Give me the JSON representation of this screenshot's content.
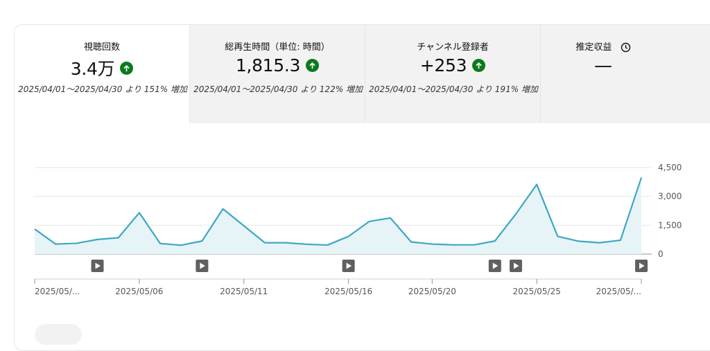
{
  "metrics": [
    {
      "label": "視聴回数",
      "value": "3.4万",
      "trend_icon": "arrow-up-circle-icon",
      "compare": "2025/04/01～2025/04/30 より 151% 増加",
      "active": true
    },
    {
      "label": "総再生時間（単位: 時間）",
      "value": "1,815.3",
      "trend_icon": "arrow-up-circle-icon",
      "compare": "2025/04/01～2025/04/30 より 122% 増加",
      "active": false
    },
    {
      "label": "チャンネル登録者",
      "value": "+253",
      "trend_icon": "arrow-up-circle-icon",
      "compare": "2025/04/01～2025/04/30 より 191% 増加",
      "active": false
    },
    {
      "label": "推定収益",
      "value": "—",
      "icon": "clock-icon",
      "active": false
    }
  ],
  "colors": {
    "line": "#3ea6c4",
    "fill": "#e6f4f7",
    "trend_up": "#0b7a1c",
    "marker": "#606060"
  },
  "chart_data": {
    "type": "area",
    "x": [
      "2025/05/01",
      "2025/05/02",
      "2025/05/03",
      "2025/05/04",
      "2025/05/05",
      "2025/05/06",
      "2025/05/07",
      "2025/05/08",
      "2025/05/09",
      "2025/05/10",
      "2025/05/11",
      "2025/05/12",
      "2025/05/13",
      "2025/05/14",
      "2025/05/15",
      "2025/05/16",
      "2025/05/17",
      "2025/05/18",
      "2025/05/19",
      "2025/05/20",
      "2025/05/21",
      "2025/05/22",
      "2025/05/23",
      "2025/05/24",
      "2025/05/25",
      "2025/05/26",
      "2025/05/27",
      "2025/05/28",
      "2025/05/29",
      "2025/05/30"
    ],
    "series": [
      {
        "values": [
          1300,
          520,
          560,
          760,
          850,
          2150,
          550,
          460,
          680,
          2350,
          1470,
          590,
          590,
          510,
          470,
          920,
          1700,
          1880,
          630,
          520,
          480,
          480,
          680,
          2080,
          3620,
          920,
          670,
          590,
          720,
          3980
        ]
      }
    ],
    "yticks": [
      "4,500",
      "3,000",
      "1,500",
      "0"
    ],
    "ylim": [
      0,
      4500
    ],
    "xtick_labels": [
      "2025/05/...",
      "2025/05/06",
      "2025/05/11",
      "2025/05/16",
      "2025/05/20",
      "2025/05/25",
      "2025/05/..."
    ],
    "xtick_dates": [
      "2025/05/01",
      "2025/05/06",
      "2025/05/11",
      "2025/05/16",
      "2025/05/20",
      "2025/05/25",
      "2025/05/30"
    ],
    "video_markers": [
      "2025/05/04",
      "2025/05/09",
      "2025/05/16",
      "2025/05/23",
      "2025/05/24",
      "2025/05/30"
    ],
    "grid": true,
    "legend": "none"
  }
}
